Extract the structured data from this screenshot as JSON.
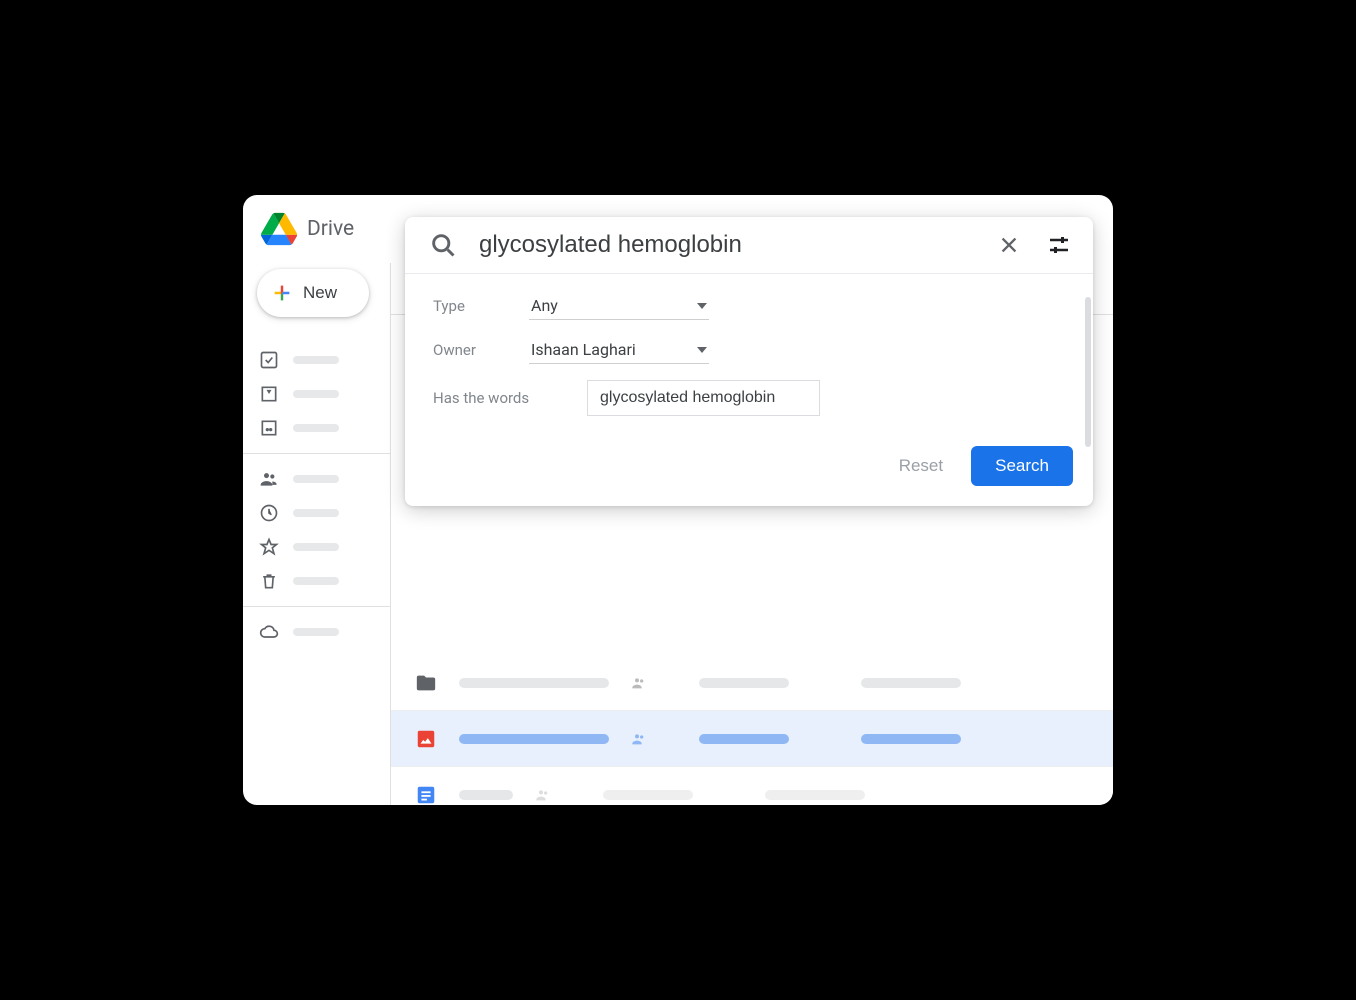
{
  "app": {
    "name": "Drive"
  },
  "sidebar": {
    "new_label": "New"
  },
  "search": {
    "query": "glycosylated hemoglobin",
    "filters": {
      "type_label": "Type",
      "type_value": "Any",
      "owner_label": "Owner",
      "owner_value": "Ishaan Laghari",
      "words_label": "Has the words",
      "words_value": "glycosylated hemoglobin"
    },
    "actions": {
      "reset": "Reset",
      "search": "Search"
    }
  }
}
